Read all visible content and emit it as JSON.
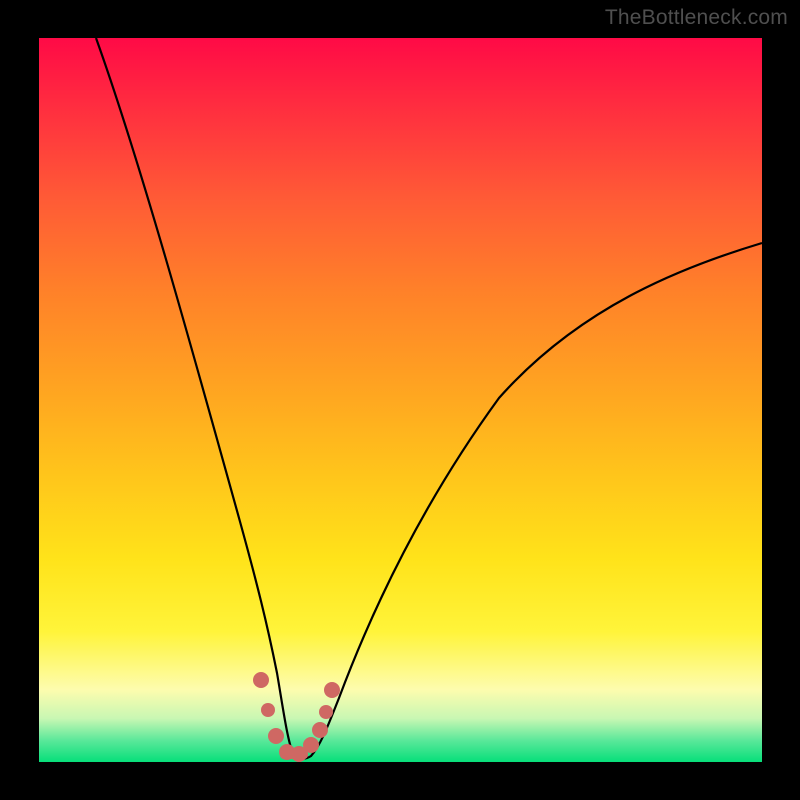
{
  "watermark": "TheBottleneck.com",
  "chart_data": {
    "type": "line",
    "title": "",
    "xlabel": "",
    "ylabel": "",
    "xlim": [
      0,
      100
    ],
    "ylim": [
      0,
      100
    ],
    "grid": false,
    "series": [
      {
        "name": "bottleneck-curve",
        "x": [
          8,
          12,
          16,
          20,
          24,
          26,
          28,
          30,
          31,
          32,
          33,
          34,
          35,
          36,
          38,
          40,
          44,
          50,
          58,
          68,
          80,
          92,
          100
        ],
        "y": [
          100,
          85,
          70,
          55,
          40,
          32,
          24,
          15,
          10,
          6,
          3,
          1,
          0.5,
          0.5,
          1,
          3,
          8,
          18,
          30,
          42,
          53,
          61,
          66
        ]
      }
    ],
    "markers": {
      "name": "highlight-dots",
      "color": "#d06a66",
      "points": [
        {
          "x": 30.5,
          "y": 10
        },
        {
          "x": 31.8,
          "y": 5
        },
        {
          "x": 33.0,
          "y": 2
        },
        {
          "x": 34.5,
          "y": 0.8
        },
        {
          "x": 36.0,
          "y": 0.8
        },
        {
          "x": 37.4,
          "y": 1.5
        },
        {
          "x": 38.8,
          "y": 4
        },
        {
          "x": 39.6,
          "y": 7
        },
        {
          "x": 40.4,
          "y": 10
        }
      ]
    }
  }
}
